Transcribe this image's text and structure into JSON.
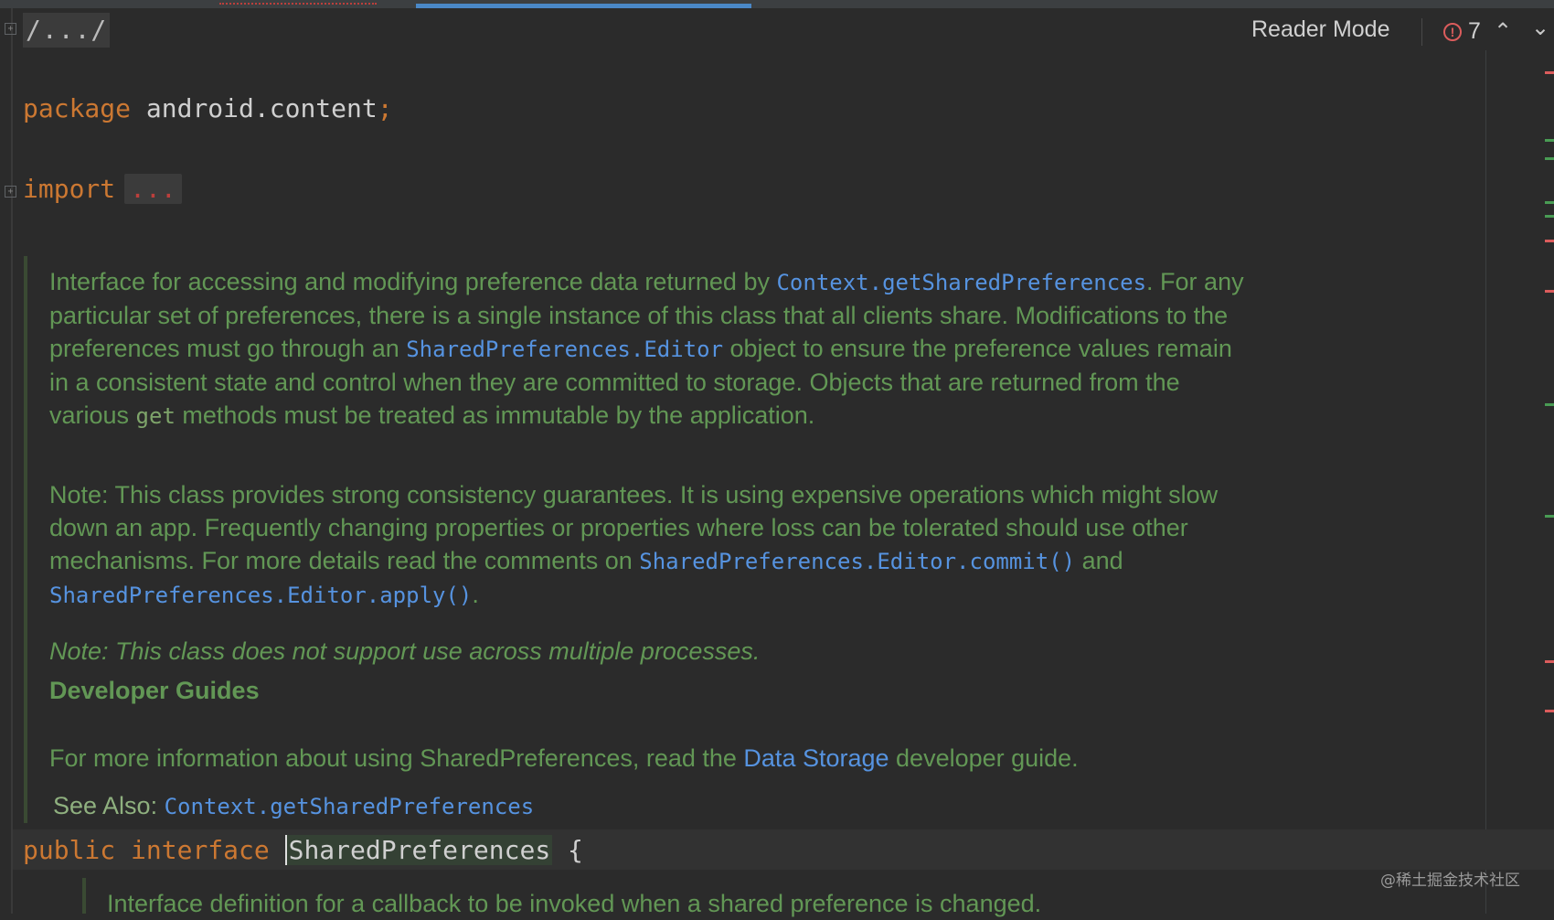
{
  "editor": {
    "collapsed_header": "/.../",
    "reader_mode_label": "Reader Mode",
    "error_count": "7",
    "error_icon_glyph": "!",
    "chevron_up": "⌃",
    "chevron_down": "⌄",
    "fold_glyph": "+"
  },
  "code": {
    "package_kw": "package",
    "package_name": "android.content",
    "semicolon": ";",
    "import_kw": "import",
    "import_collapsed": "...",
    "public_kw": "public",
    "interface_kw": "interface",
    "class_name": "SharedPreferences",
    "brace": "{"
  },
  "doc": {
    "p1_a": "Interface for accessing and modifying preference data returned by ",
    "p1_link1": "Context.getSharedPreferences",
    "p1_b": ". For any particular set of preferences, there is a single instance of this class that all clients share. Modifications to the preferences must go through an ",
    "p1_link2": "SharedPreferences.Editor",
    "p1_c": " object to ensure the preference values remain in a consistent state and control when they are committed to storage. Objects that are returned from the various ",
    "p1_code": "get",
    "p1_d": " methods must be treated as immutable by the application.",
    "p2_a": "Note: This class provides strong consistency guarantees. It is using expensive operations which might slow down an app. Frequently changing properties or properties where loss can be tolerated should use other mechanisms. For more details read the comments on ",
    "p2_link1": "SharedPreferences.Editor.commit()",
    "p2_b": " and ",
    "p2_link2": "SharedPreferences.Editor.apply()",
    "p2_c": ".",
    "p3_note": "Note: This class does not support use across multiple processes.",
    "guides_heading": "Developer Guides",
    "p4_a": "For more information about using SharedPreferences, read the ",
    "p4_link": "Data Storage",
    "p4_b": " developer guide.",
    "see_also_label": "See Also: ",
    "see_also_link": "Context.getSharedPreferences",
    "inner_doc": "Interface definition for a callback to be invoked when a shared preference is changed."
  },
  "colors": {
    "keyword": "#cc7832",
    "doc_text": "#629755",
    "link": "#5693e0",
    "error": "#db5c5c",
    "ok_marker": "#499c54"
  },
  "watermark": "@稀土掘金技术社区"
}
